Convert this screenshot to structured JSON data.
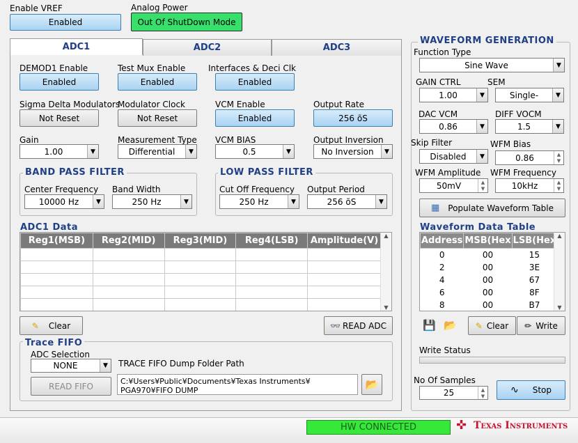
{
  "top": {
    "vref_label": "Enable VREF",
    "vref_button": "Enabled",
    "analog_label": "Analog Power",
    "analog_button": "Out Of ShutDown Mode"
  },
  "tabs": [
    "ADC1",
    "ADC2",
    "ADC3"
  ],
  "adc": {
    "demod_label": "DEMOD1 Enable",
    "demod_button": "Enabled",
    "testmux_label": "Test Mux Enable",
    "testmux_button": "Enabled",
    "interfaces_label": "Interfaces & Deci Clk",
    "interfaces_button": "Enabled",
    "sigma_label": "Sigma Delta Modulators",
    "sigma_button": "Not Reset",
    "modclk_label": "Modulator Clock",
    "modclk_button": "Not Reset",
    "vcm_label": "VCM Enable",
    "vcm_button": "Enabled",
    "outrate_label": "Output Rate",
    "outrate_button": "256 õS",
    "gain_label": "Gain",
    "gain_value": "1.00",
    "meas_label": "Measurement Type",
    "meas_value": "Differential",
    "vcmbias_label": "VCM BIAS",
    "vcmbias_value": "0.5",
    "outinv_label": "Output Inversion",
    "outinv_value": "No Inversion",
    "bpf": {
      "title": "BAND PASS FILTER",
      "center_label": "Center Frequency",
      "center_value": "10000 Hz",
      "bw_label": "Band Width",
      "bw_value": "250 Hz"
    },
    "lpf": {
      "title": "LOW PASS FILTER",
      "cutoff_label": "Cut Off Frequency",
      "cutoff_value": "250 Hz",
      "period_label": "Output Period",
      "period_value": "256 õS"
    },
    "data_title": "ADC1 Data",
    "columns": [
      "Reg1(MSB)",
      "Reg2(MID)",
      "Reg3(MID)",
      "Reg4(LSB)",
      "Amplitude(V)"
    ],
    "clear_button": "Clear",
    "read_button": "READ ADC",
    "fifo": {
      "title": "Trace FIFO",
      "adc_sel_label": "ADC Selection",
      "adc_sel_value": "NONE",
      "read_button": "READ FIFO",
      "folder_label": "TRACE FIFO Dump Folder Path",
      "folder_value": "C:¥Users¥Public¥Documents¥Texas Instruments¥",
      "folder_value2": "PGA970¥FIFO DUMP"
    }
  },
  "wave": {
    "title": "WAVEFORM GENERATION",
    "func_label": "Function Type",
    "func_value": "Sine Wave",
    "gainctrl_label": "GAIN CTRL",
    "gainctrl_value": "1.00",
    "sem_label": "SEM",
    "sem_value": "Single-",
    "dacvcm_label": "DAC VCM",
    "dacvcm_value": "0.86",
    "diffvocm_label": "DIFF VOCM",
    "diffvocm_value": "1.5",
    "skip_label": "Skip Filter",
    "skip_value": "Disabled",
    "bias_label": "WFM Bias",
    "bias_value": "0.86",
    "amp_label": "WFM Amplitude",
    "amp_value": "50mV",
    "freq_label": "WFM Frequency",
    "freq_value": "10kHz",
    "populate_button": "Populate Waveform Table",
    "table_title": "Waveform Data Table",
    "columns": [
      "Address",
      "MSB(Hex",
      "LSB(Hex"
    ],
    "rows": [
      [
        "0",
        "00",
        "15"
      ],
      [
        "2",
        "00",
        "3E"
      ],
      [
        "4",
        "00",
        "67"
      ],
      [
        "6",
        "00",
        "8F"
      ],
      [
        "8",
        "00",
        "B7"
      ]
    ],
    "clear_button": "Clear",
    "write_button": "Write",
    "status_label": "Write Status",
    "samples_label": "No Of  Samples",
    "samples_value": "25",
    "stop_button": "Stop"
  },
  "status": {
    "hw": "HW CONNECTED",
    "brand": "Texas Instruments",
    "colors": {
      "hw_bg": "#36e83a",
      "accent": "#1f3f86",
      "brand_red": "#c8102e"
    }
  }
}
